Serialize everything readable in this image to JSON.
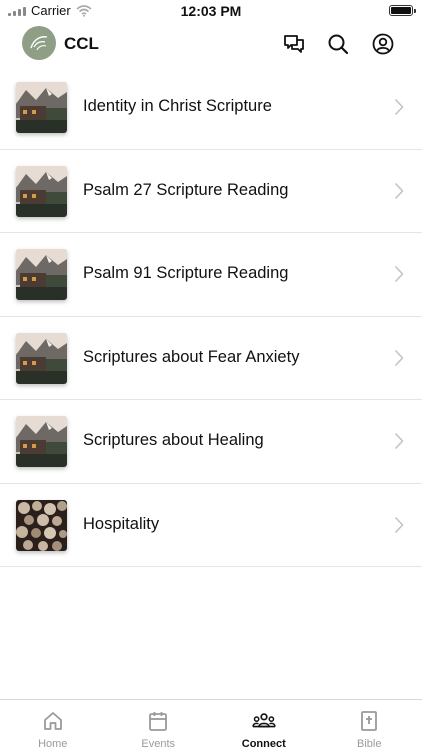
{
  "status_bar": {
    "carrier": "Carrier",
    "time": "12:03 PM"
  },
  "header": {
    "title": "CCL",
    "icons": [
      "chat-icon",
      "search-icon",
      "profile-icon"
    ]
  },
  "list": [
    {
      "title": "Identity in Christ Scripture",
      "thumbnail": "mountain-cabin"
    },
    {
      "title": "Psalm 27 Scripture Reading",
      "thumbnail": "mountain-cabin"
    },
    {
      "title": "Psalm 91 Scripture Reading",
      "thumbnail": "mountain-cabin"
    },
    {
      "title": "Scriptures about Fear Anxiety",
      "thumbnail": "mountain-cabin"
    },
    {
      "title": "Scriptures about Healing",
      "thumbnail": "mountain-cabin"
    },
    {
      "title": "Hospitality",
      "thumbnail": "stacked-logs"
    }
  ],
  "tabs": [
    {
      "label": "Home",
      "icon": "home-icon",
      "active": false
    },
    {
      "label": "Events",
      "icon": "calendar-icon",
      "active": false
    },
    {
      "label": "Connect",
      "icon": "people-icon",
      "active": true
    },
    {
      "label": "Bible",
      "icon": "bible-icon",
      "active": false
    }
  ]
}
